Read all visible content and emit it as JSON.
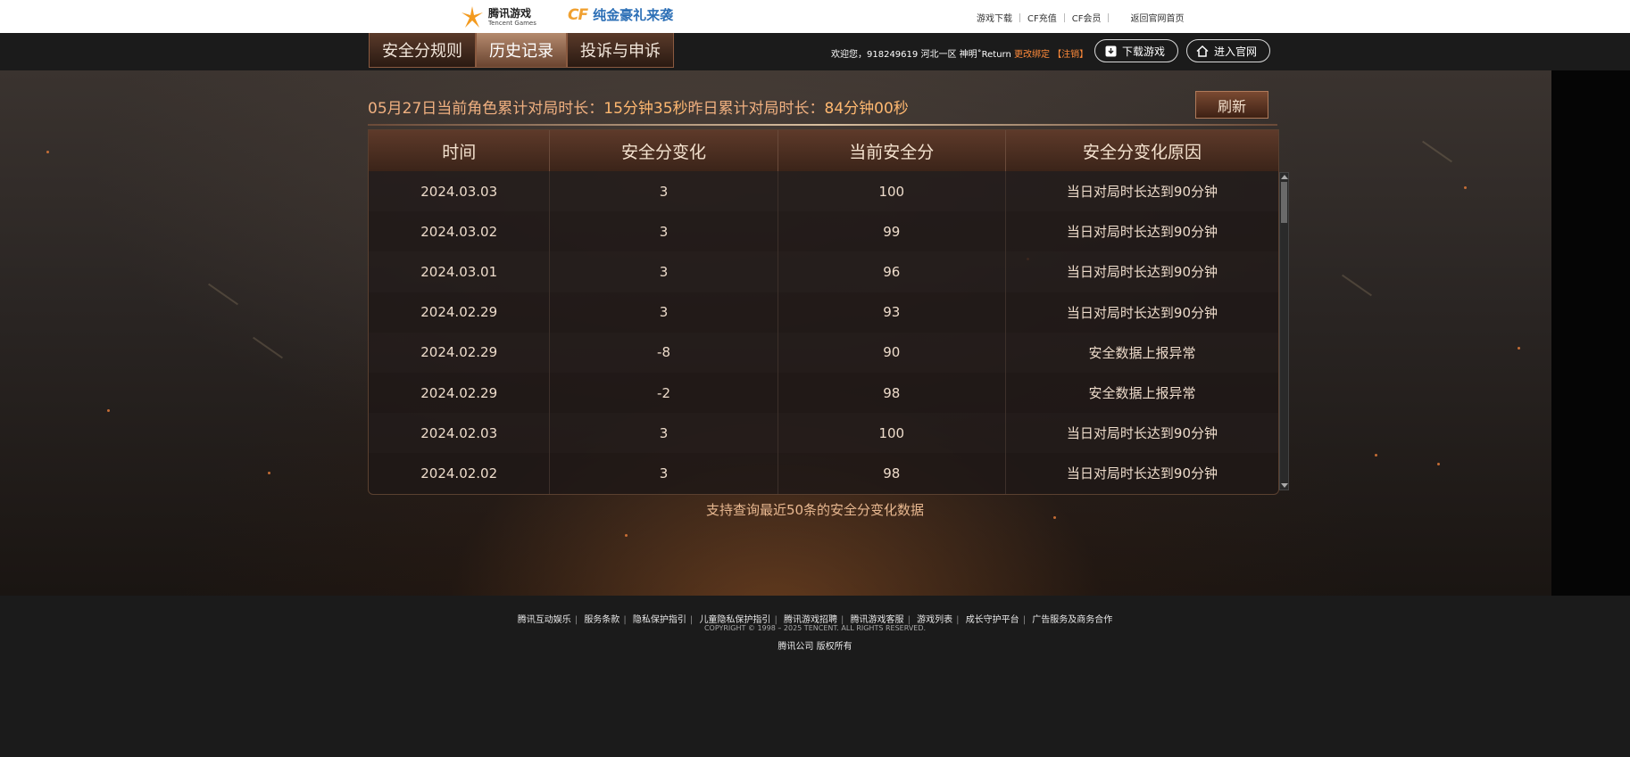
{
  "topbar": {
    "brand_cn": "腾讯游戏",
    "brand_en": "Tencent Games",
    "cf_mark": "CF",
    "cf_title": "纯金豪礼来袭",
    "links": [
      "游戏下载",
      "CF充值",
      "CF会员"
    ],
    "back_link": "返回官网首页"
  },
  "nav": {
    "tabs": [
      {
        "label": "安全分规则",
        "active": false
      },
      {
        "label": "历史记录",
        "active": true
      },
      {
        "label": "投诉与申诉",
        "active": false
      }
    ],
    "welcome_prefix": "欢迎您，918249619 河北一区 神明˚Return",
    "change_bind": "更改绑定",
    "logout": "【注销】",
    "download_label": "下载游戏",
    "site_label": "进入官网"
  },
  "stats": {
    "date_label": "05月27日当前角色累计对局时长：",
    "today_value": "15分钟35秒",
    "yesterday_label": "昨日累计对局时长：",
    "yesterday_value": "84分钟00秒",
    "refresh_label": "刷新"
  },
  "table": {
    "headers": [
      "时间",
      "安全分变化",
      "当前安全分",
      "安全分变化原因"
    ],
    "rows": [
      [
        "2024.03.03",
        "3",
        "100",
        "当日对局时长达到90分钟"
      ],
      [
        "2024.03.02",
        "3",
        "99",
        "当日对局时长达到90分钟"
      ],
      [
        "2024.03.01",
        "3",
        "96",
        "当日对局时长达到90分钟"
      ],
      [
        "2024.02.29",
        "3",
        "93",
        "当日对局时长达到90分钟"
      ],
      [
        "2024.02.29",
        "-8",
        "90",
        "安全数据上报异常"
      ],
      [
        "2024.02.29",
        "-2",
        "98",
        "安全数据上报异常"
      ],
      [
        "2024.02.03",
        "3",
        "100",
        "当日对局时长达到90分钟"
      ],
      [
        "2024.02.02",
        "3",
        "98",
        "当日对局时长达到90分钟"
      ]
    ]
  },
  "note": "支持查询最近50条的安全分变化数据",
  "footer": {
    "links": [
      "腾讯互动娱乐",
      "服务条款",
      "隐私保护指引",
      "儿童隐私保护指引",
      "腾讯游戏招聘",
      "腾讯游戏客服",
      "游戏列表",
      "成长守护平台",
      "广告服务及商务合作"
    ],
    "copyright": "COPYRIGHT © 1998 – 2025 TENCENT. ALL RIGHTS RESERVED.",
    "company": "腾讯公司 版权所有"
  },
  "colors": {
    "accent": "#ffb870",
    "header_bg": "#5e3a2a",
    "orange_link": "#ff8a3a"
  }
}
